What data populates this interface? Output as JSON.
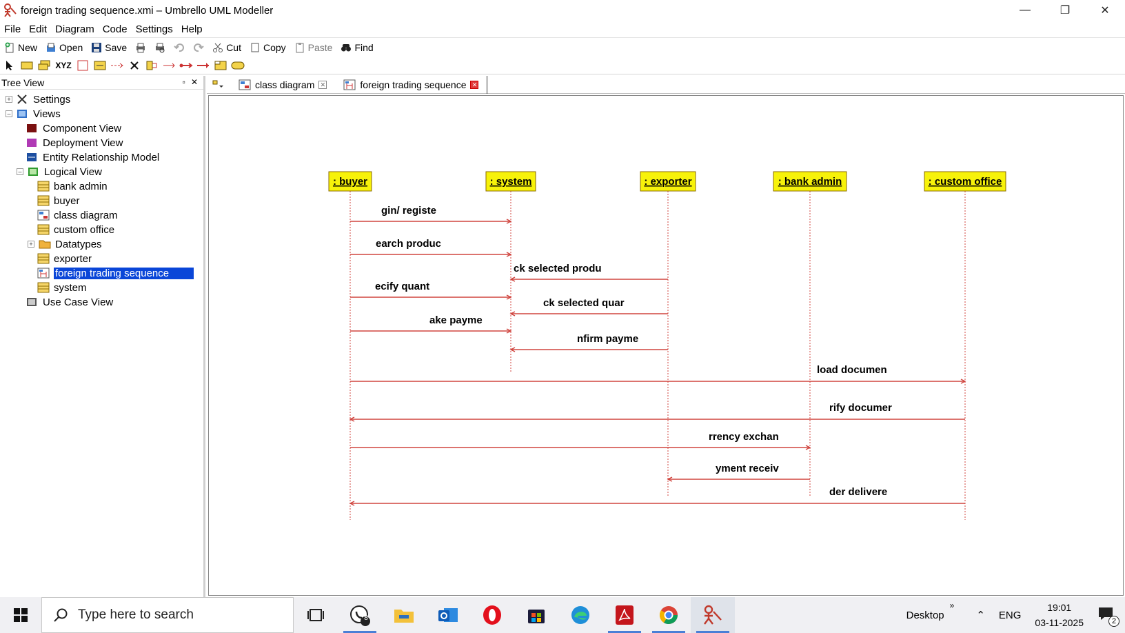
{
  "window": {
    "title": "foreign trading sequence.xmi – Umbrello UML Modeller",
    "minimize": "—",
    "restore": "❐",
    "close": "✕"
  },
  "menu": [
    "File",
    "Edit",
    "Diagram",
    "Code",
    "Settings",
    "Help"
  ],
  "toolbar": {
    "new": "New",
    "open": "Open",
    "save": "Save",
    "cut": "Cut",
    "copy": "Copy",
    "paste": "Paste",
    "find": "Find"
  },
  "toolbar2": {
    "xyz": "XYZ"
  },
  "tree": {
    "header": "Tree View",
    "items": [
      {
        "label": "Settings"
      },
      {
        "label": "Views"
      },
      {
        "label": "Component View"
      },
      {
        "label": "Deployment View"
      },
      {
        "label": "Entity Relationship Model"
      },
      {
        "label": "Logical View"
      },
      {
        "label": "bank admin"
      },
      {
        "label": "buyer"
      },
      {
        "label": "class diagram"
      },
      {
        "label": "custom office"
      },
      {
        "label": "Datatypes"
      },
      {
        "label": "exporter"
      },
      {
        "label": "foreign trading  sequence"
      },
      {
        "label": "system"
      },
      {
        "label": "Use Case View"
      }
    ]
  },
  "tabs": [
    {
      "label": "class diagram"
    },
    {
      "label": "foreign trading  sequence"
    }
  ],
  "sequence": {
    "lifelines": [
      {
        "label": ": buyer"
      },
      {
        "label": ": system"
      },
      {
        "label": ": exporter"
      },
      {
        "label": ": bank admin"
      },
      {
        "label": ": custom office"
      }
    ],
    "messages": [
      {
        "label": "gin/ registe"
      },
      {
        "label": "earch produc"
      },
      {
        "label": "ck selected produ"
      },
      {
        "label": "ecify quant"
      },
      {
        "label": "ck selected quar"
      },
      {
        "label": "ake payme"
      },
      {
        "label": "nfirm payme"
      },
      {
        "label": "load documen"
      },
      {
        "label": "rify documer"
      },
      {
        "label": "rrency exchan"
      },
      {
        "label": "yment receiv"
      },
      {
        "label": "der delivere"
      }
    ],
    "colors": {
      "box_fill": "#f7f20a",
      "box_border": "#8a6a00",
      "message": "#d0453f"
    }
  },
  "taskbar": {
    "search_placeholder": "Type here to search",
    "whatsapp_badge": "8",
    "desktop": "Desktop",
    "lang": "ENG",
    "time": "19:01",
    "date": "03-11-2025",
    "notif_count": "2"
  }
}
